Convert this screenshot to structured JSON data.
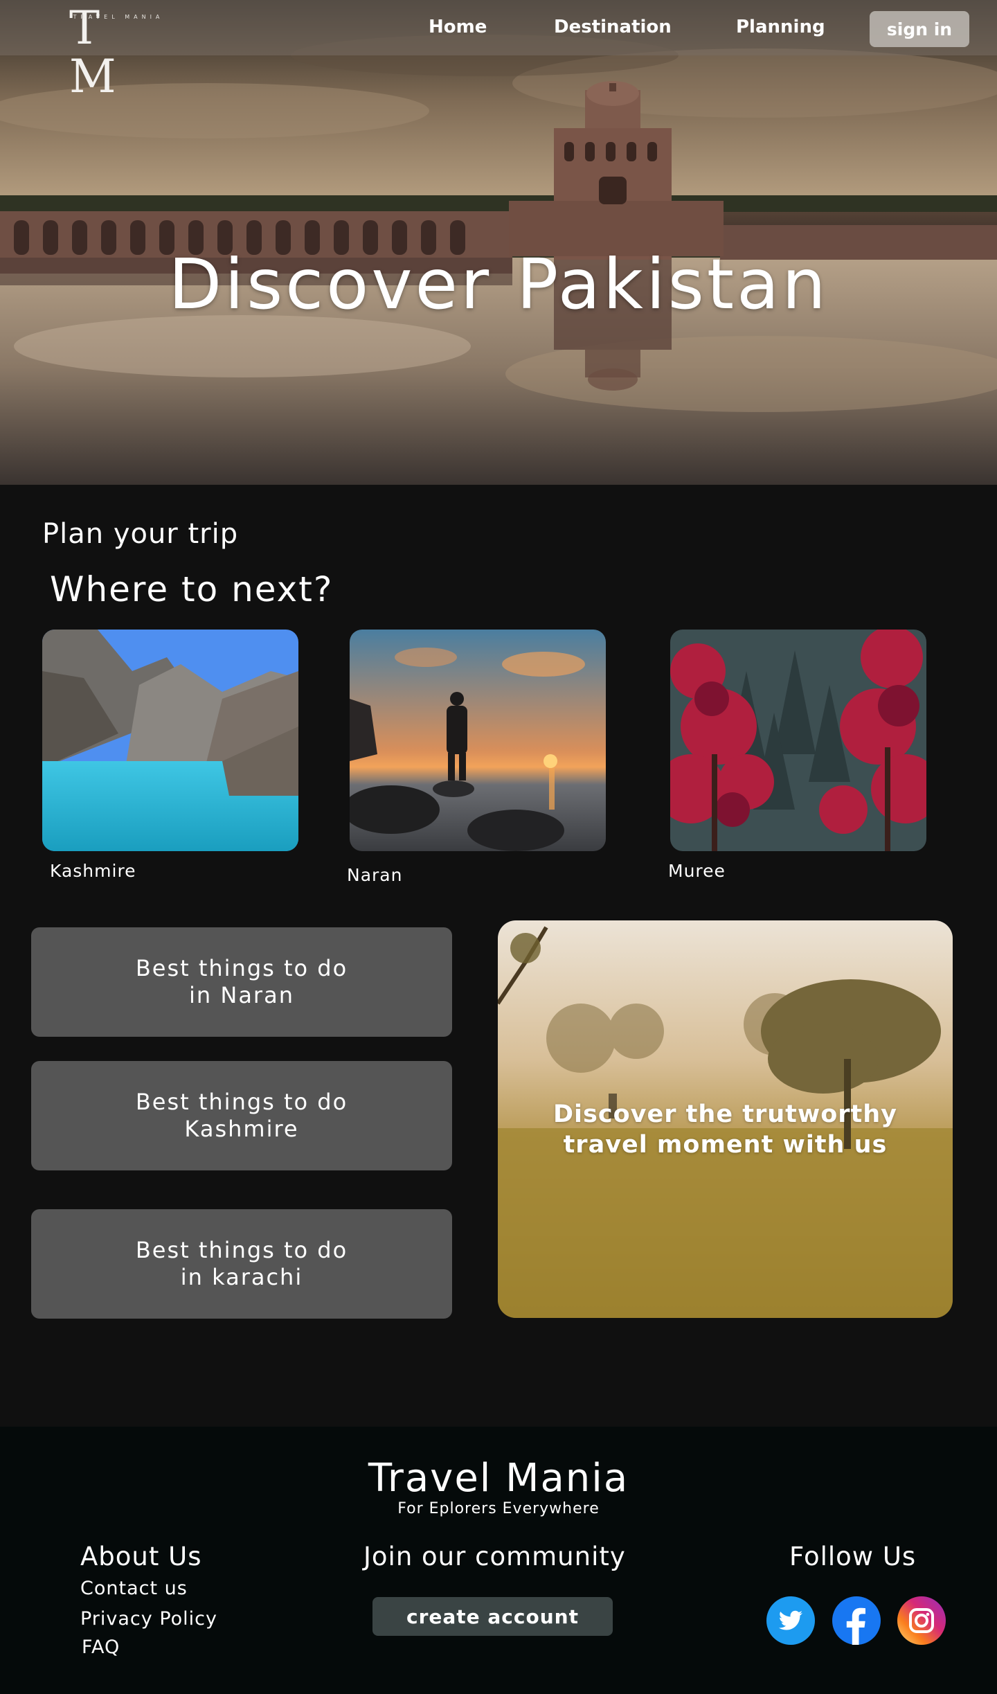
{
  "nav": {
    "logo_letters": "T M",
    "logo_subtitle": "TRAVEL MANIA",
    "links": [
      "Home",
      "Destination",
      "Planning"
    ],
    "signin_label": "sign in"
  },
  "hero": {
    "title": "Discover Pakistan"
  },
  "plan": {
    "eyebrow": "Plan your trip",
    "heading": "Where to next?",
    "destinations": [
      {
        "label": "Kashmire"
      },
      {
        "label": "Naran"
      },
      {
        "label": "Muree"
      }
    ]
  },
  "todo": {
    "items": [
      {
        "line1": "Best things to do",
        "line2": "in Naran"
      },
      {
        "line1": "Best things to do",
        "line2": "Kashmire"
      },
      {
        "line1": "Best things to do",
        "line2": "in karachi"
      }
    ],
    "promo_text": "Discover the trutworthy travel moment with us"
  },
  "footer": {
    "brand": "Travel Mania",
    "tagline": "For Eplorers Everywhere",
    "about_heading": "About Us",
    "about_links": [
      "Contact us",
      "Privacy Policy",
      "FAQ"
    ],
    "join_heading": "Join our community",
    "create_account_label": "create account",
    "follow_heading": "Follow Us",
    "socials": [
      "twitter-icon",
      "facebook-icon",
      "instagram-icon"
    ]
  },
  "colors": {
    "background": "#101010",
    "footer_bg": "#050a0a",
    "card_button": "#555555",
    "twitter": "#1d9bf0",
    "facebook": "#1877f2"
  }
}
